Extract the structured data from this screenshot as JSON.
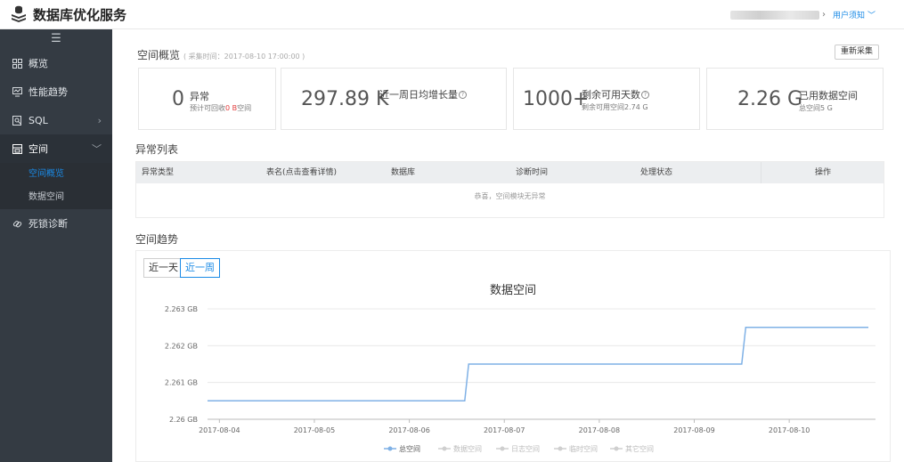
{
  "app": {
    "title": "数据库优化服务"
  },
  "header": {
    "user_notice": "用户须知"
  },
  "sidebar": {
    "items": [
      {
        "label": "概览",
        "icon": "grid-icon"
      },
      {
        "label": "性能趋势",
        "icon": "monitor-icon"
      },
      {
        "label": "SQL",
        "icon": "sql-search-icon"
      },
      {
        "label": "空间",
        "icon": "storage-icon"
      },
      {
        "label": "死锁诊断",
        "icon": "link-icon"
      }
    ],
    "sub_items": [
      {
        "label": "空间概览"
      },
      {
        "label": "数据空间"
      }
    ]
  },
  "overview": {
    "title": "空间概览",
    "collect_time": "( 采集时间：2017-08-10 17:00:00 )",
    "recollect_label": "重新采集"
  },
  "cards": {
    "anomaly": {
      "count": "0",
      "label": "异常",
      "sub_prefix": "预计可回收",
      "sub_value": "0 B",
      "sub_suffix": "空间"
    },
    "growth": {
      "value": "297.89 K",
      "label": "近一周日均增长量"
    },
    "days": {
      "value": "1000+",
      "label": "剩余可用天数",
      "sub": "剩余可用空间2.74 G"
    },
    "used": {
      "value": "2.26 G",
      "label": "已用数据空间",
      "sub": "总空间5 G"
    }
  },
  "anomaly_list": {
    "title": "异常列表",
    "columns": [
      "异常类型",
      "表名(点击查看详情)",
      "数据库",
      "诊断时间",
      "处理状态",
      "操作"
    ],
    "empty_text": "恭喜，空间模块无异常"
  },
  "trend": {
    "title": "空间趋势",
    "range_options": [
      "近一天",
      "近一周"
    ],
    "selected_range": "近一周"
  },
  "chart_data": {
    "type": "line",
    "title": "数据空间",
    "unit": "GB",
    "x_ticks": [
      "2017-08-04",
      "2017-08-05",
      "2017-08-06",
      "2017-08-07",
      "2017-08-08",
      "2017-08-09",
      "2017-08-10"
    ],
    "y_ticks": [
      2.26,
      2.261,
      2.262,
      2.263
    ],
    "y_tick_labels": [
      "2.26 GB",
      "2.261 GB",
      "2.262 GB",
      "2.263 GB"
    ],
    "ylim": [
      2.26,
      2.263
    ],
    "xlim": [
      "2017-08-03T21:00",
      "2017-08-10T20:00"
    ],
    "series": [
      {
        "name": "总空间",
        "color": "#7fb1e6",
        "points": [
          {
            "x": "2017-08-03T21:00",
            "y": 2.2605
          },
          {
            "x": "2017-08-06T14:00",
            "y": 2.2605
          },
          {
            "x": "2017-08-06T15:00",
            "y": 2.2615
          },
          {
            "x": "2017-08-09T12:00",
            "y": 2.2615
          },
          {
            "x": "2017-08-09T13:00",
            "y": 2.2625
          },
          {
            "x": "2017-08-10T20:00",
            "y": 2.2625
          }
        ]
      }
    ],
    "legend": [
      {
        "name": "总空间",
        "active": true
      },
      {
        "name": "数据空间",
        "active": false
      },
      {
        "name": "日志空间",
        "active": false
      },
      {
        "name": "临时空间",
        "active": false
      },
      {
        "name": "其它空间",
        "active": false
      }
    ],
    "legend_position": "bottom",
    "grid": true,
    "colors": {
      "active": "#7fb1e6",
      "inactive": "#cfcfcf",
      "grid": "#e8e8e8"
    }
  }
}
